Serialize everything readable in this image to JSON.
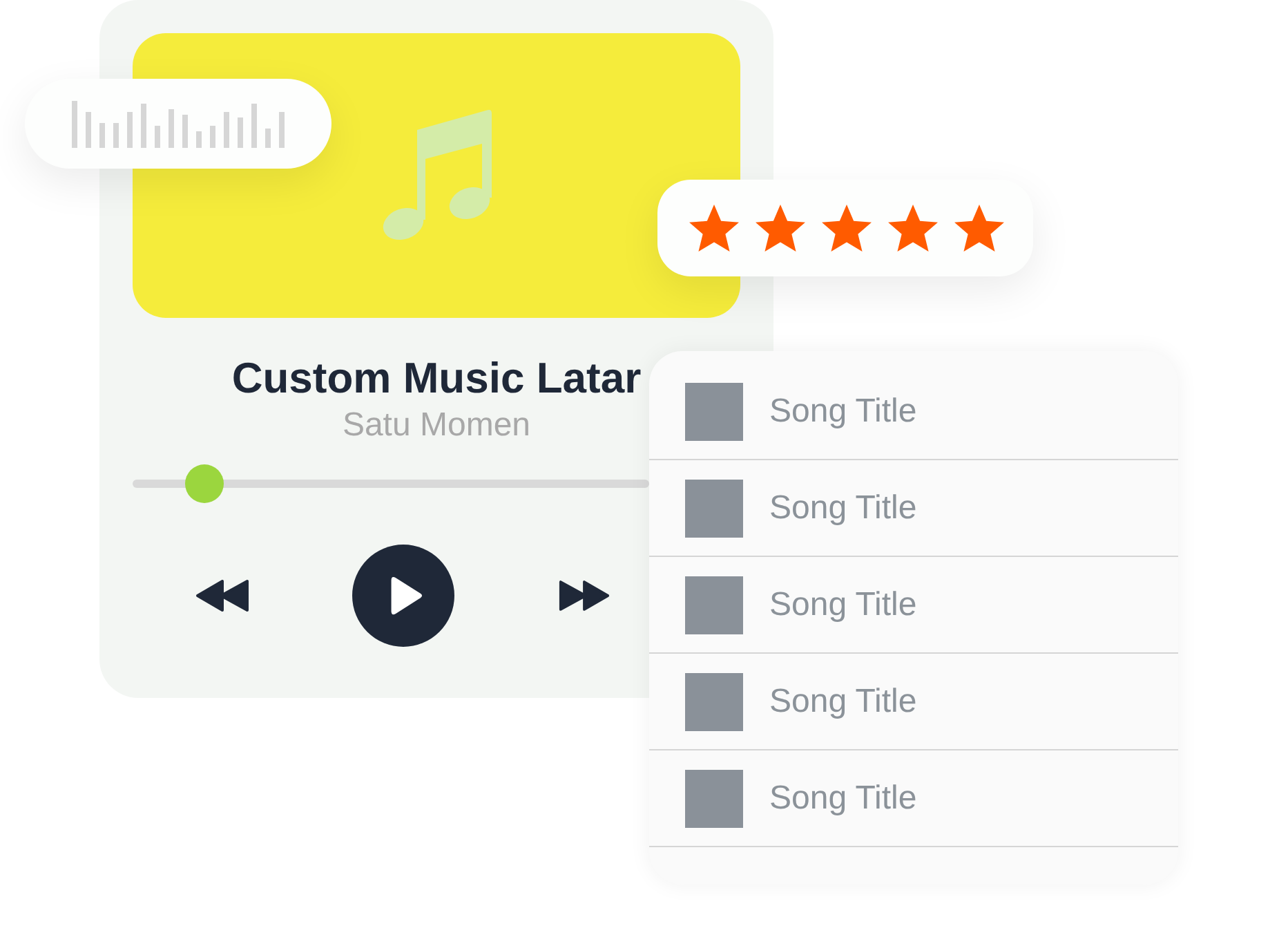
{
  "player": {
    "title": "Custom Music Latar",
    "artist": "Satu Momen",
    "progress": {
      "level": 0.14
    },
    "playing": false
  },
  "rating": {
    "stars": 5
  },
  "playlist": [
    {
      "title": "Song Title"
    },
    {
      "title": "Song Title"
    },
    {
      "title": "Song Title"
    },
    {
      "title": "Song Title"
    },
    {
      "title": "Song Title"
    }
  ]
}
